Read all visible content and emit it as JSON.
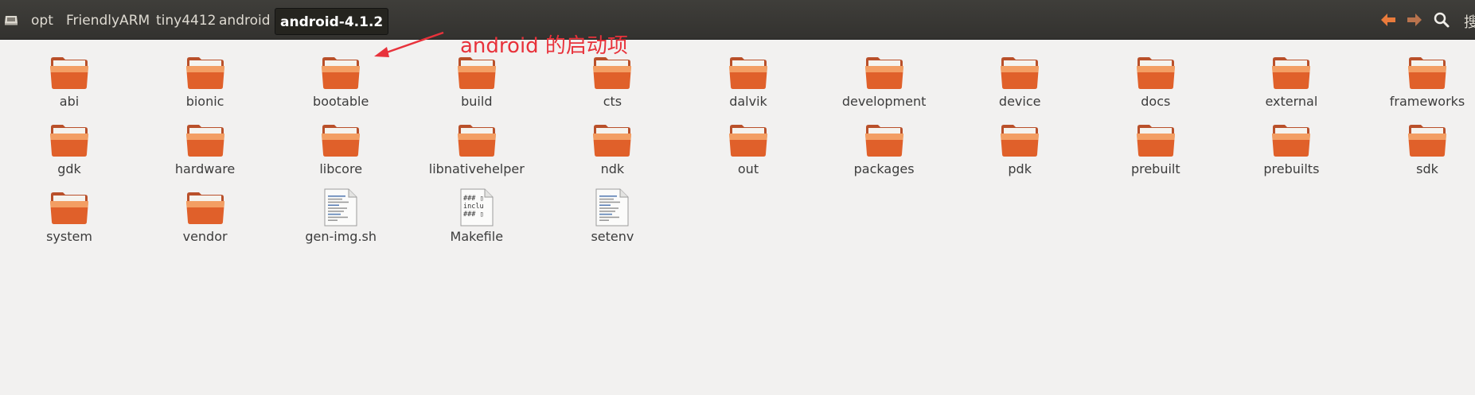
{
  "toolbar": {
    "breadcrumbs": [
      "opt",
      "FriendlyARM",
      "tiny4412",
      "android",
      "android-4.1.2"
    ],
    "search_label": "搜索",
    "colors": {
      "back_arrow": "#e97b3c",
      "forward_arrow": "#b9734d"
    }
  },
  "annotation": {
    "text": "android 的启动项",
    "color": "#e8323b"
  },
  "files": [
    {
      "name": "abi",
      "type": "folder"
    },
    {
      "name": "bionic",
      "type": "folder"
    },
    {
      "name": "bootable",
      "type": "folder"
    },
    {
      "name": "build",
      "type": "folder"
    },
    {
      "name": "cts",
      "type": "folder"
    },
    {
      "name": "dalvik",
      "type": "folder"
    },
    {
      "name": "development",
      "type": "folder"
    },
    {
      "name": "device",
      "type": "folder"
    },
    {
      "name": "docs",
      "type": "folder"
    },
    {
      "name": "external",
      "type": "folder"
    },
    {
      "name": "frameworks",
      "type": "folder"
    },
    {
      "name": "gdk",
      "type": "folder"
    },
    {
      "name": "hardware",
      "type": "folder"
    },
    {
      "name": "libcore",
      "type": "folder"
    },
    {
      "name": "libnativehelper",
      "type": "folder"
    },
    {
      "name": "ndk",
      "type": "folder"
    },
    {
      "name": "out",
      "type": "folder"
    },
    {
      "name": "packages",
      "type": "folder"
    },
    {
      "name": "pdk",
      "type": "folder"
    },
    {
      "name": "prebuilt",
      "type": "folder"
    },
    {
      "name": "prebuilts",
      "type": "folder"
    },
    {
      "name": "sdk",
      "type": "folder"
    },
    {
      "name": "system",
      "type": "folder"
    },
    {
      "name": "vendor",
      "type": "folder"
    },
    {
      "name": "gen-img.sh",
      "type": "script"
    },
    {
      "name": "Makefile",
      "type": "text",
      "preview": [
        "### ▯",
        "inclu",
        "### ▯"
      ]
    },
    {
      "name": "setenv",
      "type": "script"
    }
  ],
  "colors": {
    "folder": "#e0602a",
    "folder_light": "#f6a96d"
  }
}
